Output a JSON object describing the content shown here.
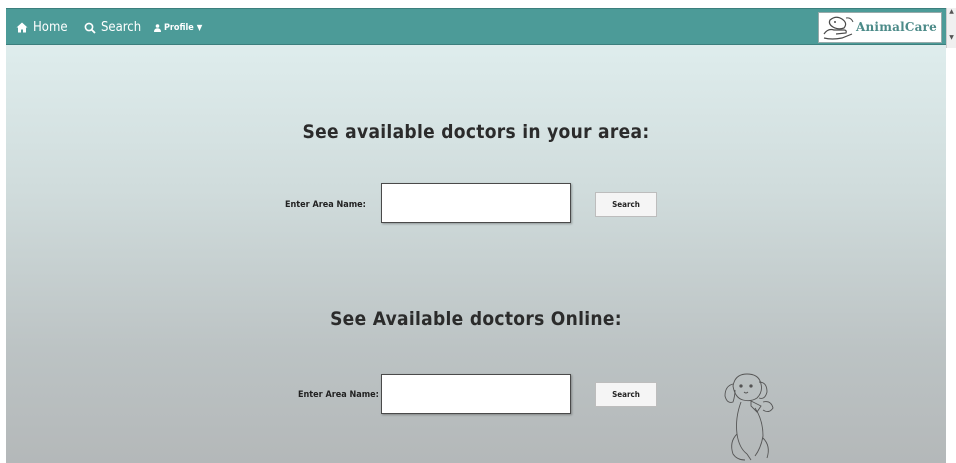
{
  "nav": {
    "home_label": "Home",
    "search_label": "Search",
    "profile_label": "Profile"
  },
  "brand": {
    "name": "AnimalCare"
  },
  "sections": [
    {
      "title": "See available doctors in your area:",
      "field_label": "Enter Area Name:",
      "input_value": "",
      "button_label": "Search"
    },
    {
      "title": "See Available doctors Online:",
      "field_label": "Enter Area Name:",
      "input_value": "",
      "button_label": "Search"
    }
  ],
  "colors": {
    "navbar": "#4c9b98",
    "brand_text": "#4b8a88",
    "title_text": "#2b2b2b"
  },
  "icons": {
    "home": "home-icon",
    "search": "search-icon",
    "profile": "user-icon",
    "dropdown": "caret-down-icon",
    "decoration": "dog-sketch-icon"
  }
}
